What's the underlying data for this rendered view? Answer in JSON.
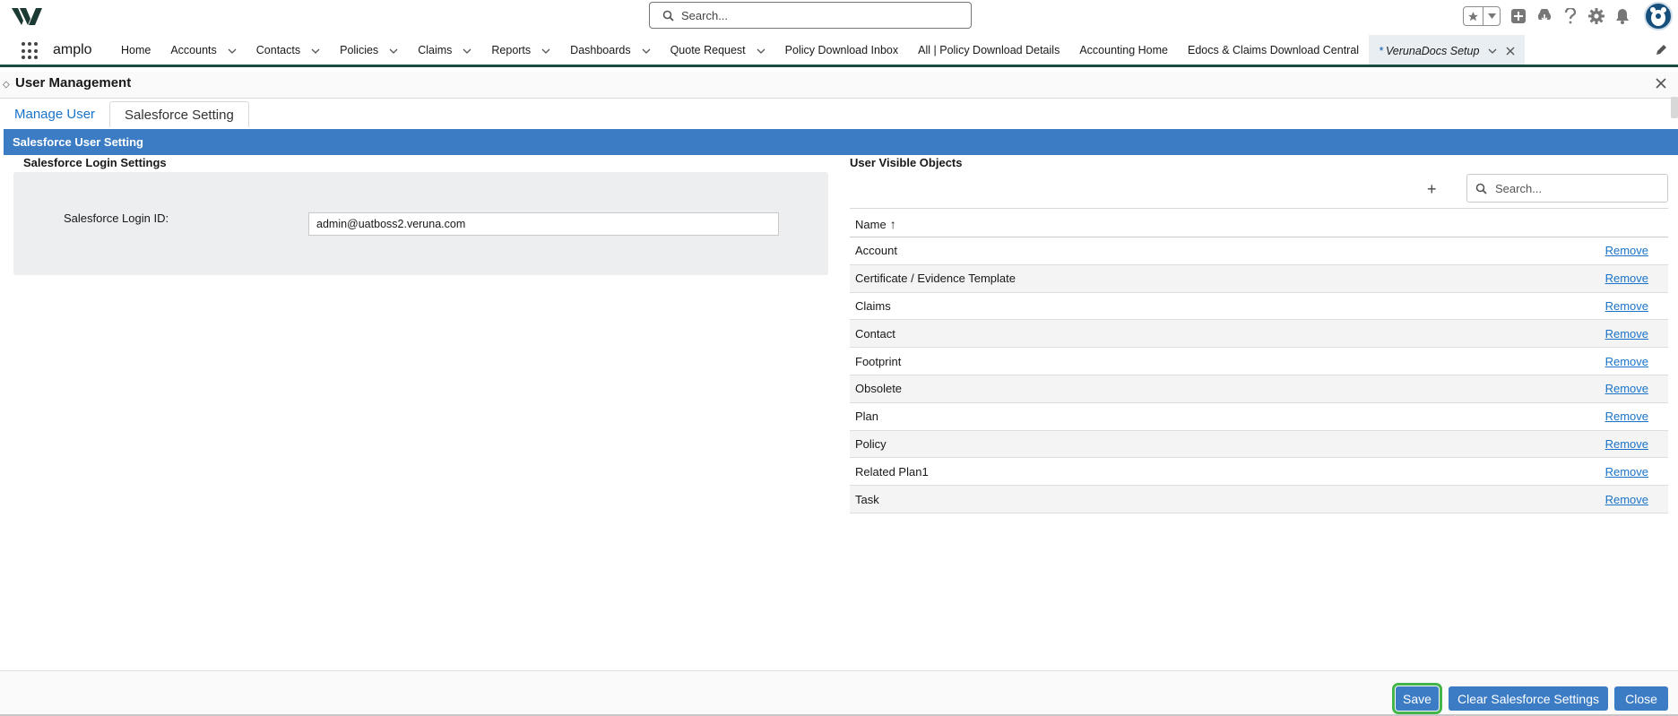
{
  "header": {
    "search_placeholder": "Search...",
    "icons": [
      "logo-icon",
      "search-icon",
      "favorites-star-icon",
      "chevron-down-icon",
      "add-icon",
      "trailhead-icon",
      "help-icon",
      "gear-icon",
      "bell-icon",
      "avatar-icon"
    ]
  },
  "nav": {
    "app_name": "amplo",
    "items": [
      {
        "label": "Home",
        "has_menu": false
      },
      {
        "label": "Accounts",
        "has_menu": true
      },
      {
        "label": "Contacts",
        "has_menu": true
      },
      {
        "label": "Policies",
        "has_menu": true
      },
      {
        "label": "Claims",
        "has_menu": true
      },
      {
        "label": "Reports",
        "has_menu": true
      },
      {
        "label": "Dashboards",
        "has_menu": true
      },
      {
        "label": "Quote Request",
        "has_menu": true
      },
      {
        "label": "Policy Download Inbox",
        "has_menu": false
      },
      {
        "label": "All | Policy Download Details",
        "has_menu": false
      },
      {
        "label": "Accounting Home",
        "has_menu": false
      },
      {
        "label": "Edocs & Claims Download Central",
        "has_menu": false
      }
    ],
    "active_tab": {
      "marker": "*",
      "label": "VerunaDocs Setup"
    }
  },
  "user_management": {
    "title": "User Management",
    "tabs": [
      "Manage User",
      "Salesforce Setting"
    ],
    "section_title": "Salesforce User Setting",
    "login_settings": {
      "heading": "Salesforce Login Settings",
      "login_id_label": "Salesforce Login ID:",
      "login_id_value": "admin@uatboss2.veruna.com"
    },
    "visible_objects": {
      "heading": "User Visible Objects",
      "search_placeholder": "Search...",
      "column_name": "Name",
      "sort_indicator": "↑",
      "remove_label": "Remove",
      "rows": [
        "Account",
        "Certificate / Evidence Template",
        "Claims",
        "Contact",
        "Footprint",
        "Obsolete",
        "Plan",
        "Policy",
        "Related Plan1",
        "Task"
      ]
    },
    "buttons": {
      "save": "Save",
      "clear": "Clear Salesforce Settings",
      "close": "Close"
    }
  },
  "colors": {
    "accent_blue": "#3b7cc4",
    "link_blue": "#1a73c9",
    "nav_underline": "#1b4b3f",
    "save_highlight": "#43b549"
  }
}
